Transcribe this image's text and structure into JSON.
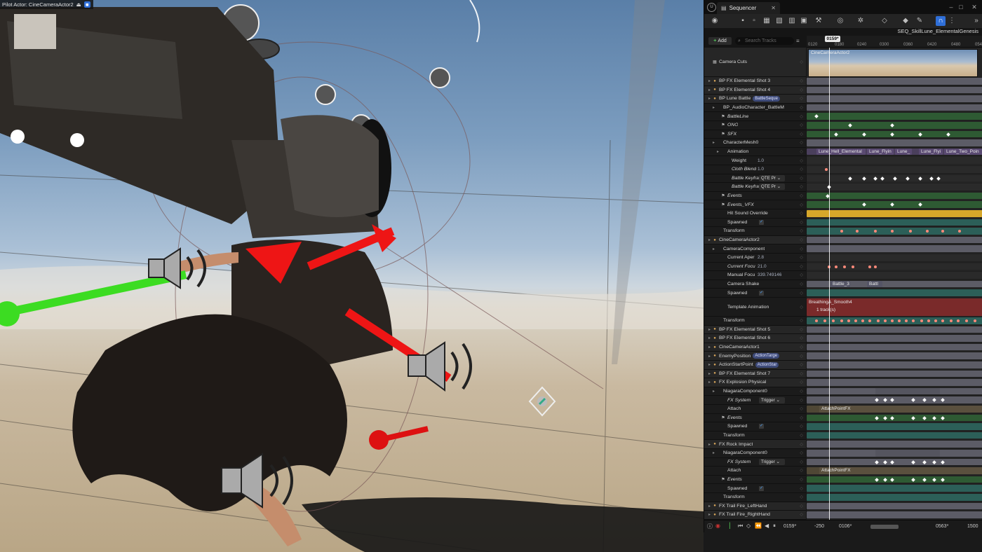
{
  "viewport": {
    "pilot_label": "Pilot Actor: CineCameraActor2"
  },
  "sequencer": {
    "tab_title": "Sequencer",
    "sequence_name": "SEQ_SkillLune_ElementalGenesis",
    "add_label": "Add",
    "search_placeholder": "Search Tracks",
    "current_frame": "0159*",
    "ruler_ticks": [
      "0120",
      "0180",
      "0240",
      "0300",
      "0360",
      "0420",
      "0480",
      "054"
    ],
    "camera_cuts_clip": "CineCameraActor2",
    "rows": [
      {
        "label": "Camera Cuts",
        "type": "section"
      },
      {
        "label": "BP FX Elemental Shot 3",
        "type": "section"
      },
      {
        "label": "BP FX Elemental Shot 4",
        "type": "section"
      },
      {
        "label": "BP Lune Battle",
        "type": "section",
        "tag": "BattleSeque"
      },
      {
        "label": "BP_AudioCharacter_BattleM",
        "type": "item"
      },
      {
        "label": "BattleLine",
        "type": "item"
      },
      {
        "label": "ONO",
        "type": "item"
      },
      {
        "label": "SFX",
        "type": "item"
      },
      {
        "label": "CharacterMesh0",
        "type": "item"
      },
      {
        "label": "Animation",
        "type": "item"
      },
      {
        "label": "Weight",
        "type": "item",
        "value": "1.0"
      },
      {
        "label": "Cloth Blend",
        "type": "item",
        "value": "1.0"
      },
      {
        "label": "Battle Keyfrar",
        "type": "item",
        "dropdown": "QTE Pr"
      },
      {
        "label": "Battle Keyfrar",
        "type": "item",
        "dropdown": "QTE Pr"
      },
      {
        "label": "Events",
        "type": "item"
      },
      {
        "label": "Events_VFX",
        "type": "item"
      },
      {
        "label": "Hit Sound Override",
        "type": "item"
      },
      {
        "label": "Spawned",
        "type": "item",
        "check": true
      },
      {
        "label": "Transform",
        "type": "item"
      },
      {
        "label": "CineCameraActor2",
        "type": "section"
      },
      {
        "label": "CameraComponent",
        "type": "item"
      },
      {
        "label": "Current Aper",
        "type": "item",
        "value": "2.8"
      },
      {
        "label": "Current Focu",
        "type": "item",
        "value": "21.0"
      },
      {
        "label": "Manual Focu",
        "type": "item",
        "value": "339.749146"
      },
      {
        "label": "Camera Shake",
        "type": "item"
      },
      {
        "label": "Spawned",
        "type": "item",
        "check": true
      },
      {
        "label": "Template Animation",
        "type": "item"
      },
      {
        "label": "Transform",
        "type": "item"
      },
      {
        "label": "BP FX Elemental Shot 5",
        "type": "section"
      },
      {
        "label": "BP FX Elemental Shot 6",
        "type": "section"
      },
      {
        "label": "CineCameraActor1",
        "type": "section"
      },
      {
        "label": "EnemyPosition",
        "type": "section",
        "tag": "ActionTarge"
      },
      {
        "label": "ActionStartPoint",
        "type": "section",
        "tag": "ActionStar"
      },
      {
        "label": "BP FX Elemental Shot 7",
        "type": "section"
      },
      {
        "label": "FX Explosion Physical",
        "type": "section"
      },
      {
        "label": "NiagaraComponent0",
        "type": "item"
      },
      {
        "label": "FX System",
        "type": "item",
        "dropdown": "Trigger"
      },
      {
        "label": "Attach",
        "type": "item"
      },
      {
        "label": "Events",
        "type": "item"
      },
      {
        "label": "Spawned",
        "type": "item",
        "check": true
      },
      {
        "label": "Transform",
        "type": "item"
      },
      {
        "label": "FX Rock Impact",
        "type": "section"
      },
      {
        "label": "NiagaraComponent0",
        "type": "item"
      },
      {
        "label": "FX System",
        "type": "item",
        "dropdown": "Trigger"
      },
      {
        "label": "Attach",
        "type": "item"
      },
      {
        "label": "Events",
        "type": "item"
      },
      {
        "label": "Spawned",
        "type": "item",
        "check": true
      },
      {
        "label": "Transform",
        "type": "item"
      },
      {
        "label": "FX Trail Fire_LeftHand",
        "type": "section"
      },
      {
        "label": "FX Trail Fire_RightHand",
        "type": "section"
      }
    ],
    "clips": {
      "anim1": "Lune_Hell_Elemental",
      "anim2": "Lune_Flyin",
      "anim3": "Lune_",
      "anim4": "Lune_Flyi",
      "anim5": "Lune_Two_Poin",
      "shake1": "Battle_3",
      "shake2": "Battl",
      "template_anim": "BreathingA_Smooth4",
      "template_tracks": "1 track(s)",
      "attach1": "AttachPointFX",
      "attach2": "AttachPointFX"
    },
    "bottom": {
      "frame": "0159*",
      "start": "-250",
      "view_start": "0106*",
      "view_end": "0563*",
      "end": "1500"
    }
  }
}
